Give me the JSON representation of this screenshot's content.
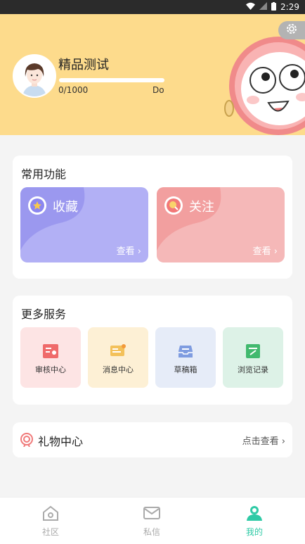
{
  "status_bar": {
    "time": "2:29"
  },
  "profile": {
    "name": "精品测试",
    "progress_text": "0/1000",
    "progress_fraction": 0,
    "level": "Do"
  },
  "common": {
    "title": "常用功能",
    "items": [
      {
        "label": "收藏",
        "view": "查看"
      },
      {
        "label": "关注",
        "view": "查看"
      }
    ]
  },
  "more": {
    "title": "更多服务",
    "items": [
      {
        "label": "审核中心"
      },
      {
        "label": "消息中心"
      },
      {
        "label": "草稿箱"
      },
      {
        "label": "浏览记录"
      }
    ]
  },
  "gift": {
    "label": "礼物中心",
    "action": "点击查看"
  },
  "tabs": [
    {
      "label": "社区"
    },
    {
      "label": "私信"
    },
    {
      "label": "我的"
    }
  ],
  "colors": {
    "header_bg": "#fddb8c",
    "collect_bg": "#b2b0f5",
    "follow_bg": "#f5b8b8",
    "accent": "#2fcaa6"
  }
}
